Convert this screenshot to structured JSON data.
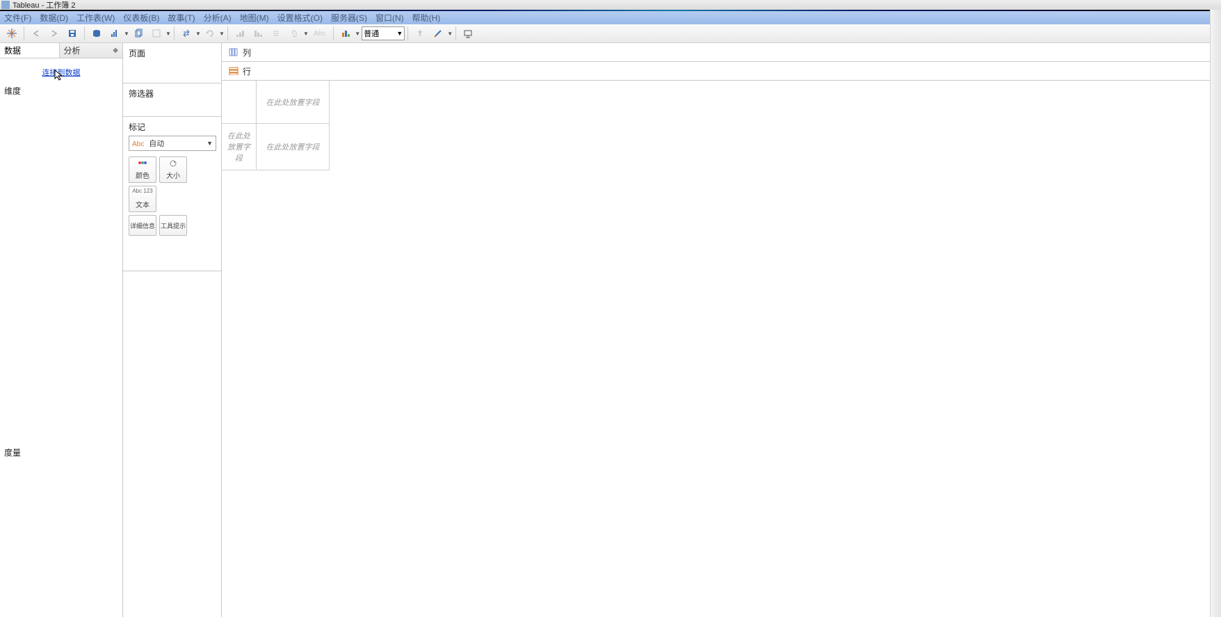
{
  "window": {
    "title": "Tableau - 工作簿 2"
  },
  "menu": {
    "file": "文件(F)",
    "data": "数据(D)",
    "worksheet": "工作表(W)",
    "dashboard": "仪表板(B)",
    "story": "故事(T)",
    "analysis": "分析(A)",
    "map": "地图(M)",
    "format": "设置格式(O)",
    "server": "服务器(S)",
    "window_m": "窗口(N)",
    "help": "帮助(H)"
  },
  "toolbar": {
    "fit_option": "普通"
  },
  "left": {
    "tab_data": "数据",
    "tab_analysis": "分析",
    "connect_link": "连接到数据",
    "dimensions_header": "维度",
    "measures_header": "度量"
  },
  "middle": {
    "pages_title": "页面",
    "filters_title": "筛选器",
    "marks_title": "标记",
    "marks_select_prefix": "Abc",
    "marks_select_label": "自动",
    "mark_color": "颜色",
    "mark_size": "大小",
    "mark_text": "文本",
    "mark_detail": "详细信息",
    "mark_tooltip": "工具提示",
    "text_icon_label": "Abc 123"
  },
  "right": {
    "columns_label": "列",
    "rows_label": "行",
    "drop_columns": "在此处放置字段",
    "drop_rows": "在此处放置字段",
    "drop_caption": "在此处放置字段"
  }
}
